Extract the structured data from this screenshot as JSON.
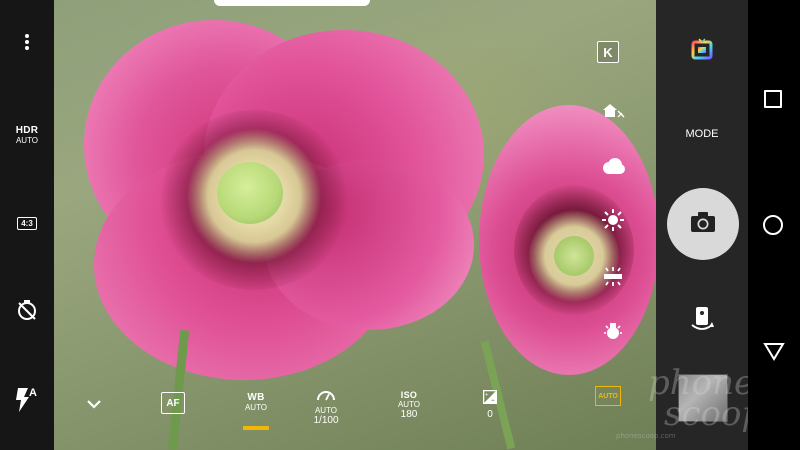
{
  "left_bar": {
    "menu_icon": "more-vert-icon",
    "hdr_label": "HDR",
    "hdr_value": "AUTO",
    "aspect_label": "4:3",
    "timer_icon": "timer-off-icon",
    "flash_icon": "flash-auto-icon",
    "flash_badge": "A"
  },
  "bottom_controls": {
    "collapse_icon": "chevron-down-icon",
    "af_label": "AF",
    "wb_label": "WB",
    "wb_value": "AUTO",
    "wb_active_color": "#f2b705",
    "shutter_value_top": "AUTO",
    "shutter_value": "1/100",
    "iso_label": "ISO",
    "iso_value_top": "AUTO",
    "iso_value": "180",
    "ev_value": "0",
    "auto_badge": "AUTO",
    "auto_badge_color": "#f2b705"
  },
  "wb_presets": {
    "k_label": "K",
    "icons": [
      "shade-icon",
      "cloudy-icon",
      "daylight-icon",
      "fluorescent-icon",
      "incandescent-icon"
    ]
  },
  "camera_panel": {
    "filters_icon": "color-filter-icon",
    "mode_label": "MODE",
    "shutter_icon": "camera-icon",
    "switch_camera_icon": "switch-camera-icon"
  },
  "watermark": {
    "line1": "phone",
    "line2": "scoop",
    "site": "phonescoop.com"
  },
  "nav_bar": {
    "recents_icon": "recents-square-icon",
    "home_icon": "home-circle-icon",
    "back_icon": "back-triangle-icon"
  }
}
